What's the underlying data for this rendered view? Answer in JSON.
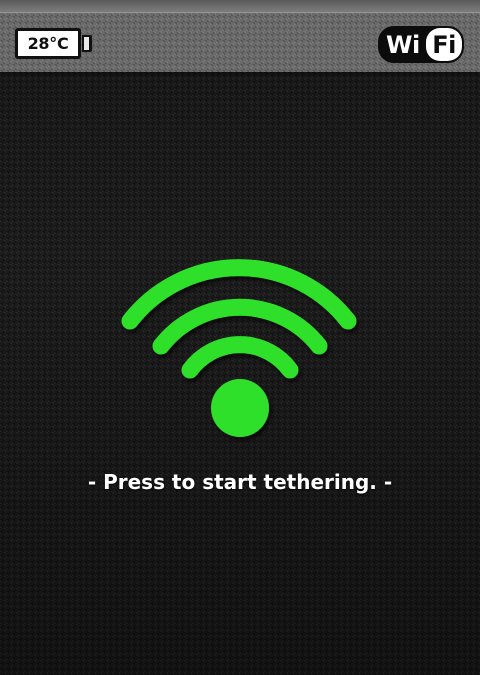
{
  "status": {
    "temperature": "28°C"
  },
  "header": {
    "logo_left": "Wi",
    "logo_right": "Fi"
  },
  "main": {
    "prompt": "- Press to start tethering. -",
    "icon": "wifi-signal-icon",
    "icon_color": "#2fe02a"
  },
  "colors": {
    "background": "#1c1c1c",
    "top_bar": "#6a6a6a",
    "accent": "#2fe02a",
    "text": "#ffffff"
  }
}
